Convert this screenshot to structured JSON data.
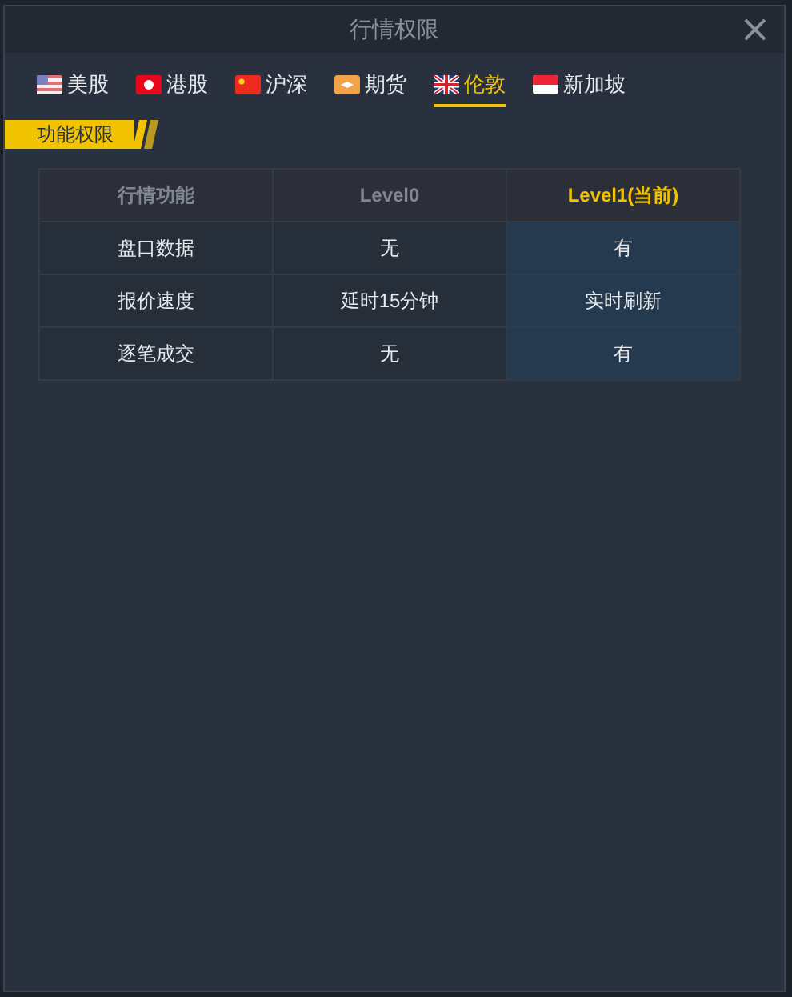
{
  "window": {
    "title": "行情权限",
    "close": "×"
  },
  "tabs": [
    {
      "label": "美股",
      "selected": false
    },
    {
      "label": "港股",
      "selected": false
    },
    {
      "label": "沪深",
      "selected": false
    },
    {
      "label": "期货",
      "selected": false
    },
    {
      "label": "伦敦",
      "selected": true
    },
    {
      "label": "新加坡",
      "selected": false
    }
  ],
  "section": {
    "title": "功能权限"
  },
  "table": {
    "columns": [
      {
        "label": "行情功能",
        "current": false
      },
      {
        "label": "Level0",
        "current": false
      },
      {
        "label": "Level1(当前)",
        "current": true
      }
    ],
    "rows": [
      [
        "盘口数据",
        "无",
        "有"
      ],
      [
        "报价速度",
        "延时15分钟",
        "实时刷新"
      ],
      [
        "逐笔成交",
        "无",
        "有"
      ]
    ]
  }
}
